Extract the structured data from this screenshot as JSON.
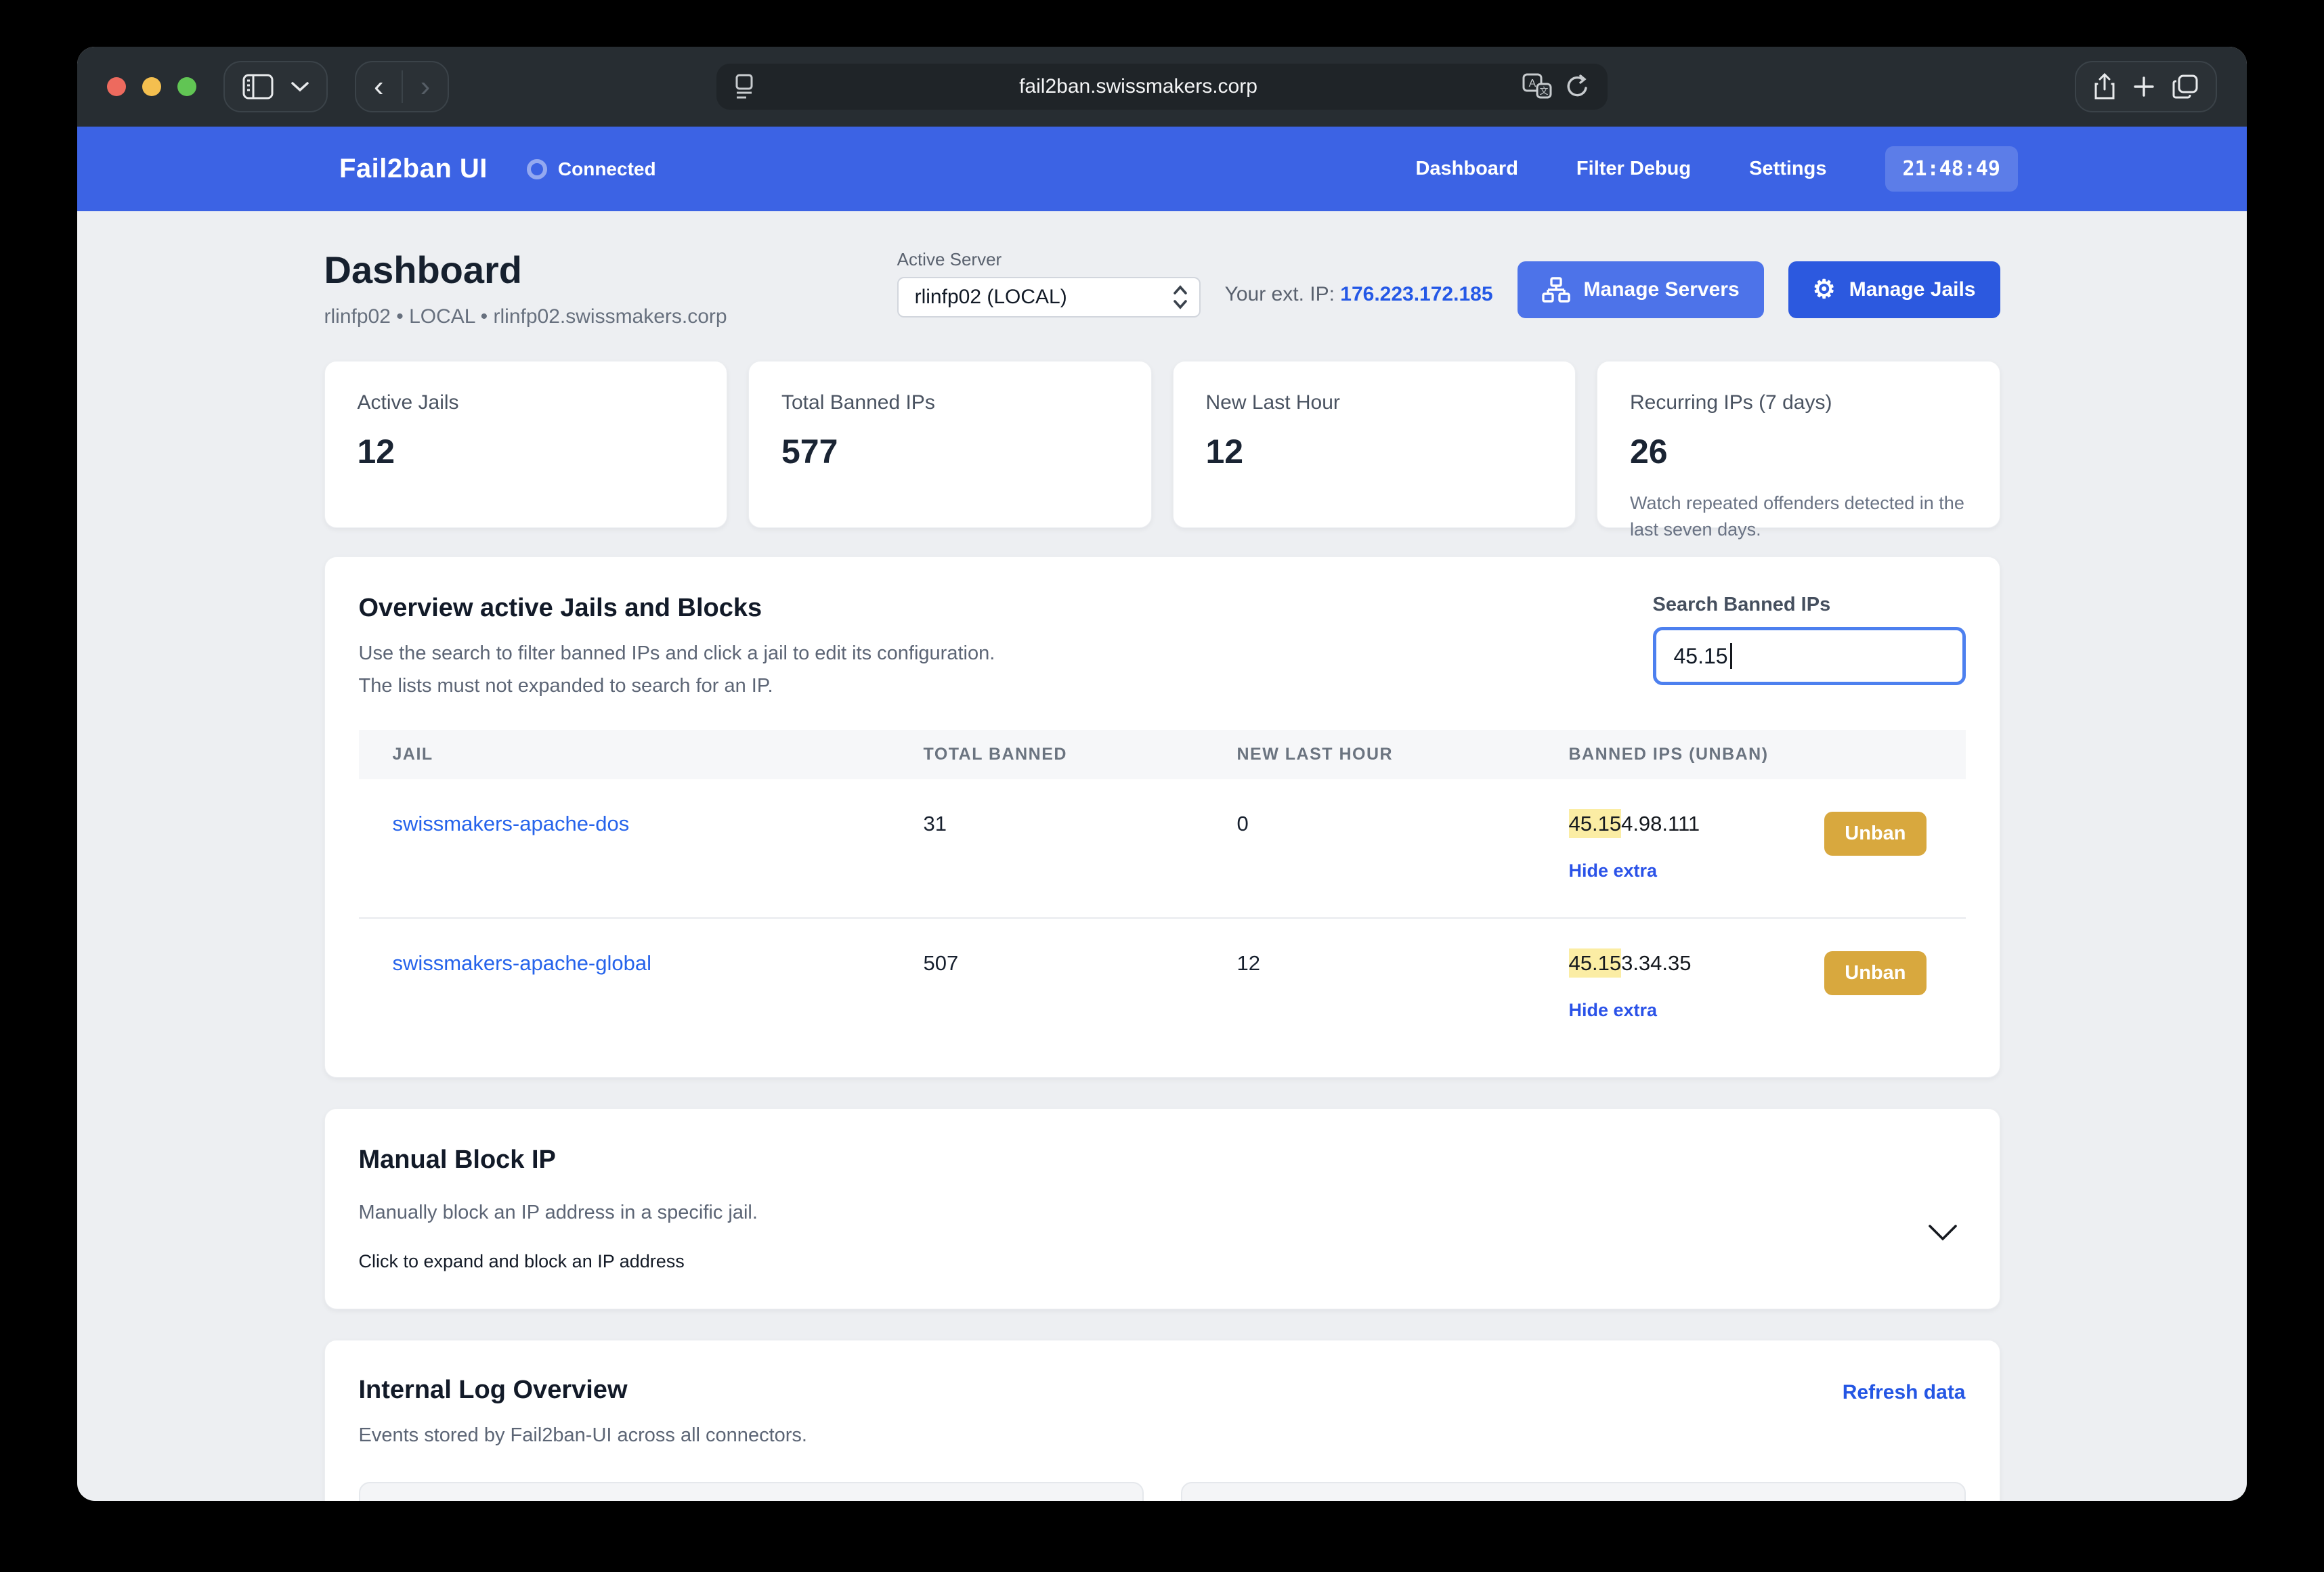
{
  "browser": {
    "url": "fail2ban.swissmakers.corp"
  },
  "header": {
    "brand": "Fail2ban UI",
    "status": "Connected",
    "nav": [
      {
        "label": "Dashboard"
      },
      {
        "label": "Filter Debug"
      },
      {
        "label": "Settings"
      }
    ],
    "clock": "21:48:49"
  },
  "page": {
    "title": "Dashboard",
    "subtitle": "rlinfp02 • LOCAL • rlinfp02.swissmakers.corp",
    "active_server": {
      "label": "Active Server",
      "selected": "rlinfp02 (LOCAL)"
    },
    "ext_ip": {
      "label": "Your ext. IP:",
      "value": "176.223.172.185"
    },
    "buttons": {
      "manage_servers": "Manage Servers",
      "manage_jails": "Manage Jails"
    }
  },
  "stats": [
    {
      "label": "Active Jails",
      "value": "12"
    },
    {
      "label": "Total Banned IPs",
      "value": "577"
    },
    {
      "label": "New Last Hour",
      "value": "12"
    },
    {
      "label": "Recurring IPs (7 days)",
      "value": "26",
      "description": "Watch repeated offenders detected in the last seven days."
    }
  ],
  "overview": {
    "title": "Overview active Jails and Blocks",
    "description1": "Use the search to filter banned IPs and click a jail to edit its configuration.",
    "description2": "The lists must not expanded to search for an IP.",
    "search": {
      "label": "Search Banned IPs",
      "value": "45.15"
    },
    "table": {
      "columns": [
        "JAIL",
        "TOTAL BANNED",
        "NEW LAST HOUR",
        "BANNED IPS (UNBAN)"
      ],
      "rows": [
        {
          "jail": "swissmakers-apache-dos",
          "total_banned": "31",
          "new_last_hour": "0",
          "ip_highlight": "45.15",
          "ip_rest": "4.98.111",
          "unban_label": "Unban",
          "hide_extra_label": "Hide extra"
        },
        {
          "jail": "swissmakers-apache-global",
          "total_banned": "507",
          "new_last_hour": "12",
          "ip_highlight": "45.15",
          "ip_rest": "3.34.35",
          "unban_label": "Unban",
          "hide_extra_label": "Hide extra"
        }
      ]
    }
  },
  "manual_block": {
    "title": "Manual Block IP",
    "description": "Manually block an IP address in a specific jail.",
    "hint": "Click to expand and block an IP address"
  },
  "internal_log": {
    "title": "Internal Log Overview",
    "description": "Events stored by Fail2ban-UI across all connectors.",
    "refresh_label": "Refresh data"
  },
  "colors": {
    "header_blue": "#3c63e4",
    "accent_blue": "#2c59df",
    "link_blue": "#2563eb",
    "unban_amber": "#d8a83e",
    "highlight_yellow": "#fbeda4",
    "chrome_dark": "#272d32"
  }
}
